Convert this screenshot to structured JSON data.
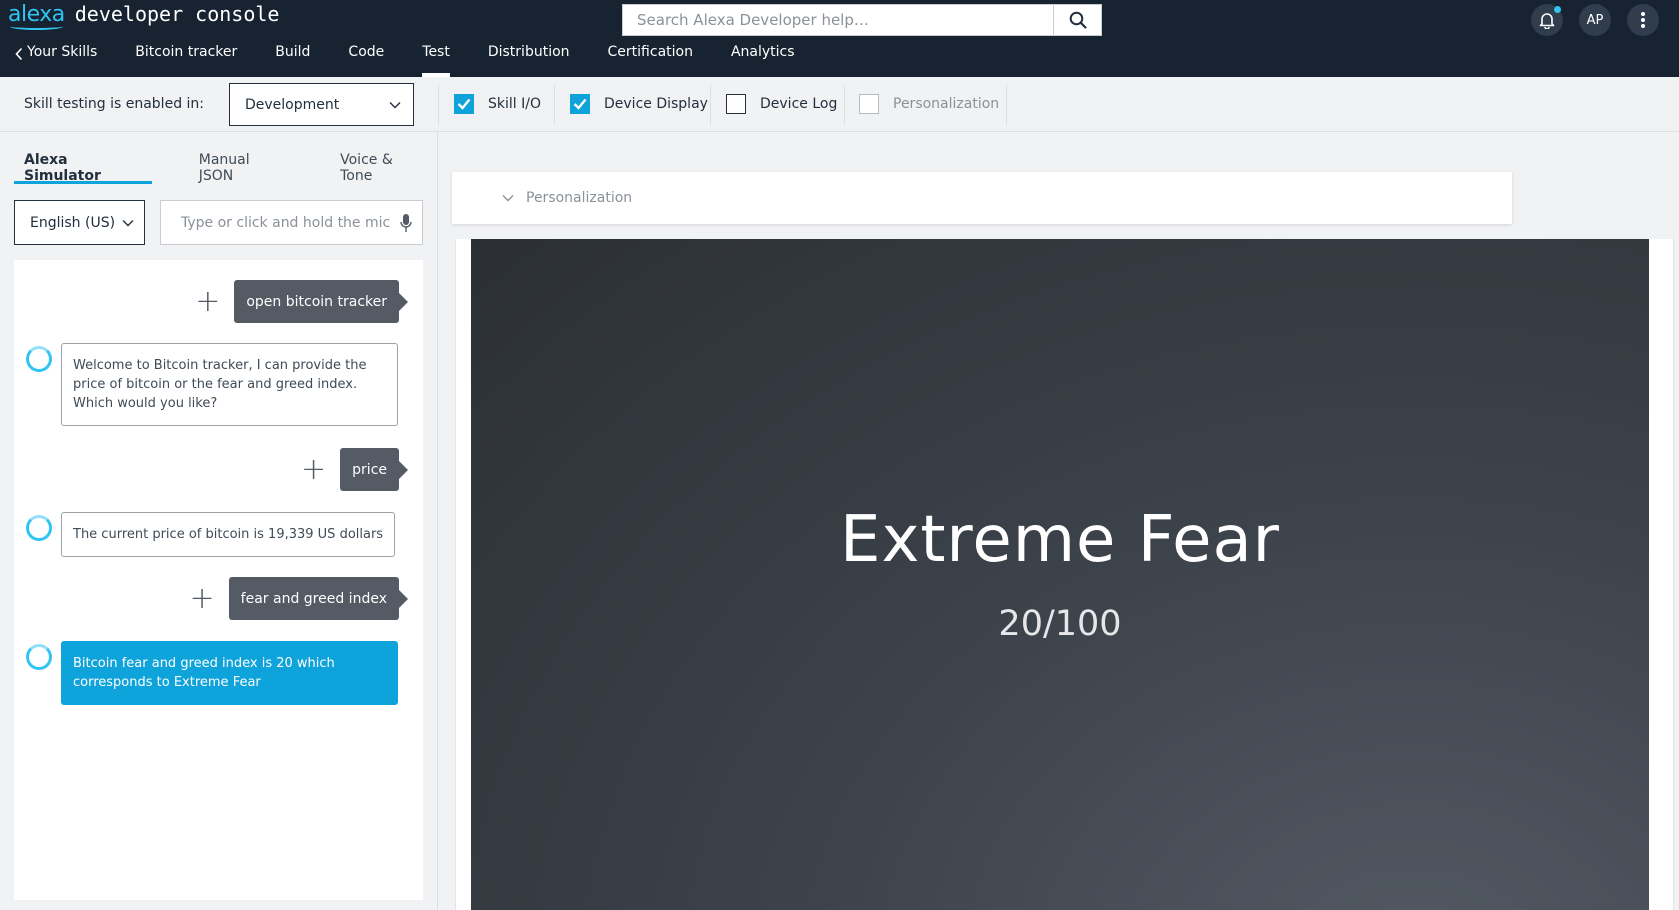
{
  "header": {
    "brand_alexa": "alexa",
    "brand_rest": "developer console",
    "search_placeholder": "Search Alexa Developer help…",
    "avatar_initials": "AP"
  },
  "nav": {
    "back_label": "Your Skills",
    "items": [
      {
        "label": "Bitcoin tracker"
      },
      {
        "label": "Build"
      },
      {
        "label": "Code"
      },
      {
        "label": "Test",
        "active": true
      },
      {
        "label": "Distribution"
      },
      {
        "label": "Certification"
      },
      {
        "label": "Analytics"
      }
    ]
  },
  "toolbar": {
    "testing_label": "Skill testing is enabled in:",
    "environment": "Development",
    "checkboxes": [
      {
        "label": "Skill I/O",
        "checked": true
      },
      {
        "label": "Device Display",
        "checked": true
      },
      {
        "label": "Device Log",
        "checked": false
      },
      {
        "label": "Personalization",
        "checked": false,
        "disabled": true
      }
    ]
  },
  "simulator": {
    "tabs": [
      {
        "label": "Alexa Simulator",
        "active": true
      },
      {
        "label": "Manual JSON"
      },
      {
        "label": "Voice & Tone"
      }
    ],
    "locale": "English (US)",
    "input_placeholder": "Type or click and hold the mic",
    "messages": [
      {
        "from": "user",
        "text": "open bitcoin tracker"
      },
      {
        "from": "alexa",
        "text": "Welcome to Bitcoin tracker, I can provide the price of bitcoin or the fear and greed index. Which would you like?"
      },
      {
        "from": "user",
        "text": "price"
      },
      {
        "from": "alexa",
        "text": "The current price of bitcoin is 19,339 US dollars"
      },
      {
        "from": "user",
        "text": "fear and greed index"
      },
      {
        "from": "alexa",
        "text": "Bitcoin fear and greed index is 20 which corresponds to Extreme Fear"
      }
    ]
  },
  "panel": {
    "personalization_label": "Personalization"
  },
  "display": {
    "title": "Extreme Fear",
    "subtitle": "20/100"
  },
  "colors": {
    "header_bg": "#172330",
    "accent": "#0ea3da",
    "alexa_ring": "#31c4f3",
    "user_bubble": "#545b64"
  }
}
